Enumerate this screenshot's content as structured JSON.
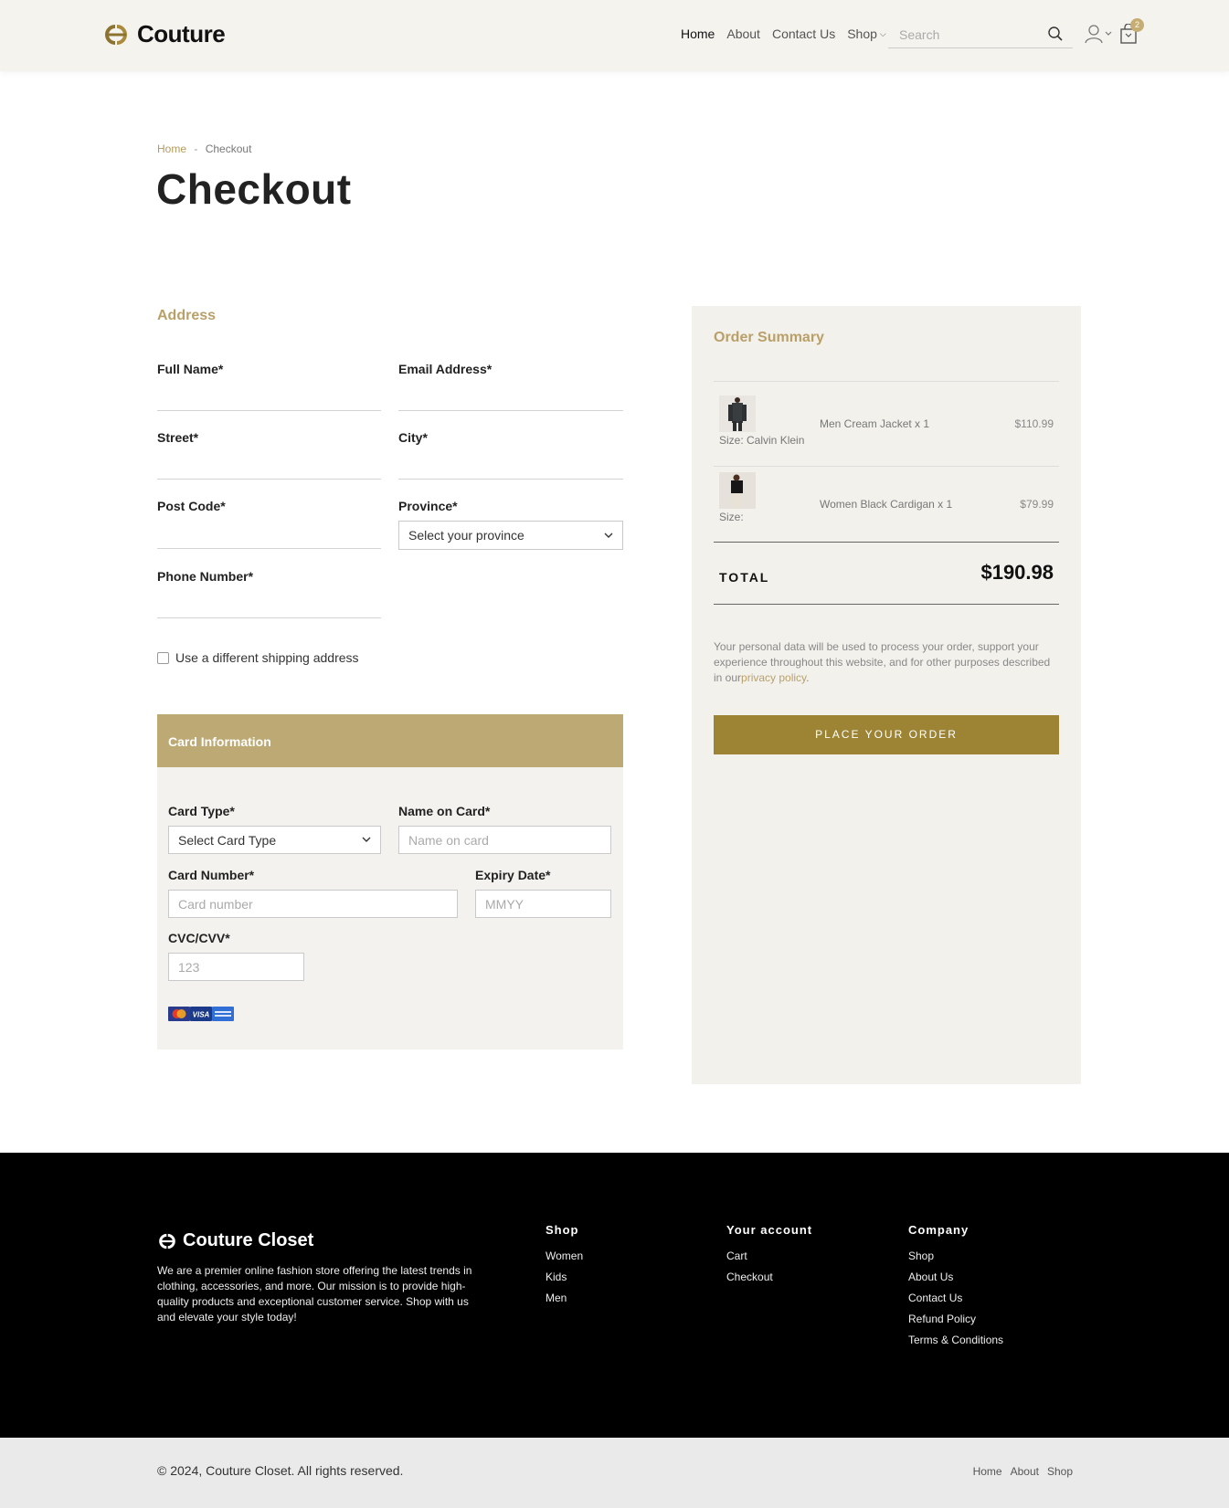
{
  "header": {
    "logo_text": "Couture",
    "nav": [
      "Home",
      "About",
      "Contact Us",
      "Shop"
    ],
    "search_placeholder": "Search",
    "cart_count": "2"
  },
  "breadcrumb": {
    "home": "Home",
    "separator": "-",
    "current": "Checkout"
  },
  "page_title": "Checkout",
  "address": {
    "title": "Address",
    "full_name_label": "Full Name*",
    "email_label": "Email Address*",
    "street_label": "Street*",
    "city_label": "City*",
    "post_code_label": "Post Code*",
    "province_label": "Province*",
    "province_value": "Select your province",
    "phone_label": "Phone Number*",
    "different_shipping_label": "Use a different shipping address"
  },
  "card": {
    "header": "Card Information",
    "card_type_label": "Card Type*",
    "card_type_value": "Select Card Type",
    "name_label": "Name on Card*",
    "name_placeholder": "Name on card",
    "number_label": "Card Number*",
    "number_placeholder": "Card number",
    "expiry_label": "Expiry Date*",
    "expiry_placeholder": "MMYY",
    "cvc_label": "CVC/CVV*",
    "cvc_placeholder": "123",
    "payment_icons": [
      "mastercard-icon",
      "visa-icon",
      "amex-icon"
    ],
    "visa_text": "VISA"
  },
  "summary": {
    "title": "Order Summary",
    "items": [
      {
        "size": "Size: Calvin Klein",
        "name": "Men Cream Jacket x 1",
        "price": "$110.99"
      },
      {
        "size": "Size:",
        "name": "Women Black Cardigan x 1",
        "price": "$79.99"
      }
    ],
    "total_label": "TOTAL",
    "total_value": "$190.98",
    "privacy_text": "Your personal data will be used to process your order, support your experience throughout this website, and for other purposes described in our",
    "privacy_link": "privacy policy",
    "privacy_end": ".",
    "place_order": "PLACE YOUR ORDER"
  },
  "footer": {
    "brand": "Couture Closet",
    "about": "We are a premier online fashion store offering the latest trends in clothing, accessories, and more. Our mission is to provide high-quality products and exceptional customer service. Shop with us and elevate your style today!",
    "shop": {
      "title": "Shop",
      "links": [
        "Women",
        "Kids",
        "Men"
      ]
    },
    "account": {
      "title": "Your account",
      "links": [
        "Cart",
        "Checkout"
      ]
    },
    "company": {
      "title": "Company",
      "links": [
        "Shop",
        "About Us",
        "Contact Us",
        "Refund Policy",
        "Terms & Conditions"
      ]
    }
  },
  "bottom_bar": {
    "copyright": "© 2024, Couture Closet. All rights reserved.",
    "links": [
      "Home",
      "About",
      "Shop"
    ]
  },
  "colors": {
    "accent_gold": "#b9a06a",
    "button_gold": "#9c8434",
    "card_header": "#bda974",
    "header_bg": "#f5f3ee"
  }
}
